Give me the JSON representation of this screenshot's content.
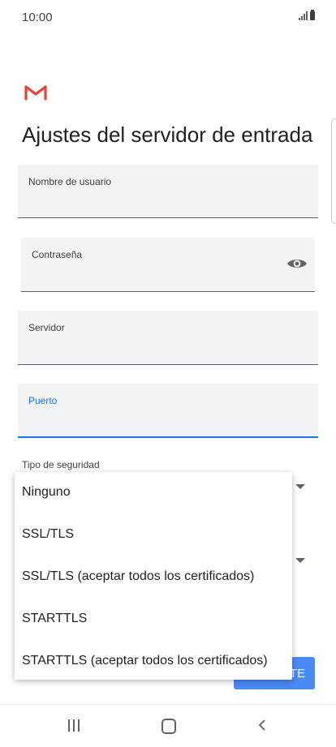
{
  "status_bar": {
    "time": "10:00"
  },
  "page": {
    "title": "Ajustes del servidor de entrada"
  },
  "fields": {
    "username": {
      "label": "Nombre de usuario",
      "value": ""
    },
    "password": {
      "label": "Contraseña",
      "value": ""
    },
    "server": {
      "label": "Servidor",
      "value": ""
    },
    "port": {
      "label": "Puerto",
      "value": ""
    }
  },
  "security": {
    "label": "Tipo de seguridad",
    "options": [
      "Ninguno",
      "SSL/TLS",
      "SSL/TLS (aceptar todos los certificados)",
      "STARTTLS",
      "STARTTLS (aceptar todos los certificados)"
    ]
  },
  "next_button": {
    "label": "TE"
  },
  "colors": {
    "accent": "#1a73e8",
    "button": "#4a8af4",
    "field_bg": "#f1f3f4",
    "gmail_red": "#ea4335"
  },
  "icons": [
    "gmail-logo",
    "eye-icon",
    "signal-icon",
    "battery-icon",
    "chevron-down-icon",
    "recents-icon",
    "home-icon",
    "back-icon"
  ]
}
